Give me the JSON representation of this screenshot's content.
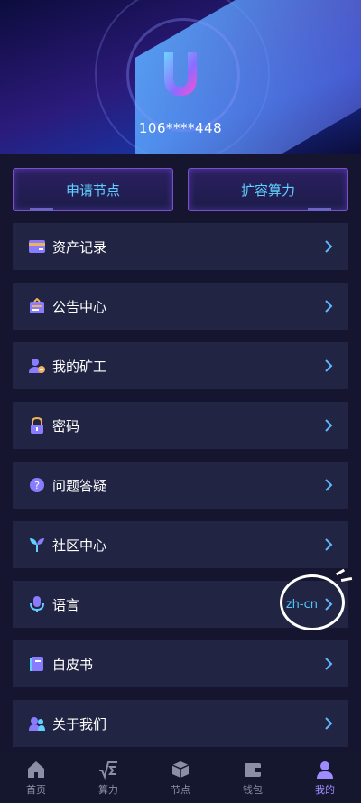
{
  "header": {
    "phone": "106****448"
  },
  "actions": {
    "apply_node": "申请节点",
    "expand_power": "扩容算力"
  },
  "menu": [
    {
      "label": "资产记录",
      "icon": "wallet-card-icon"
    },
    {
      "label": "公告中心",
      "icon": "announcement-icon"
    },
    {
      "label": "我的矿工",
      "icon": "miner-user-icon"
    },
    {
      "label": "密码",
      "icon": "lock-icon"
    },
    {
      "label": "问题答疑",
      "icon": "question-icon"
    },
    {
      "label": "社区中心",
      "icon": "sprout-icon"
    },
    {
      "label": "语言",
      "icon": "microphone-icon",
      "value": "zh-cn"
    },
    {
      "label": "白皮书",
      "icon": "book-icon"
    },
    {
      "label": "关于我们",
      "icon": "people-icon"
    }
  ],
  "tabbar": [
    {
      "label": "首页",
      "icon": "home-icon"
    },
    {
      "label": "算力",
      "icon": "sqrt-sigma-icon"
    },
    {
      "label": "节点",
      "icon": "cube-icon"
    },
    {
      "label": "钱包",
      "icon": "wallet-icon"
    },
    {
      "label": "我的",
      "icon": "user-icon",
      "active": true
    }
  ],
  "colors": {
    "background": "#151530",
    "card": "#212442",
    "accent_cyan": "#5fd0ff",
    "accent_purple": "#9e8cff"
  }
}
